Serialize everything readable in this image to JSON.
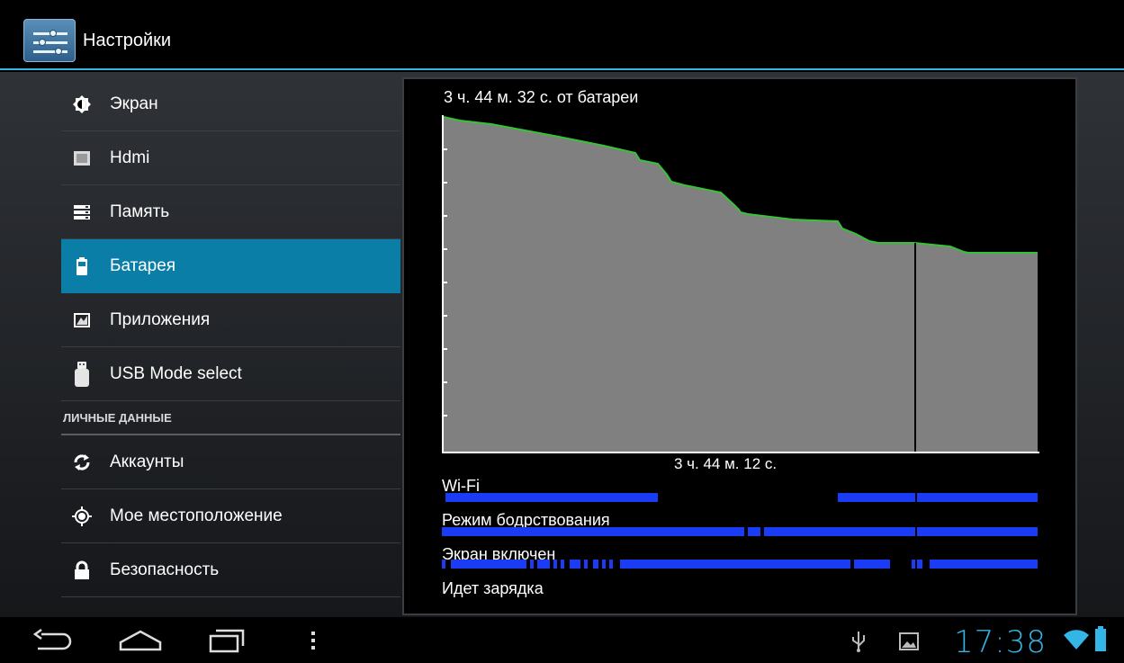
{
  "action_bar": {
    "title": "Настройки",
    "icon": "settings-icon"
  },
  "menu": {
    "items": [
      {
        "label": "Экран",
        "icon": "brightness-icon",
        "active": false
      },
      {
        "label": "Hdmi",
        "icon": "hdmi-icon",
        "active": false
      },
      {
        "label": "Память",
        "icon": "storage-icon",
        "active": false
      },
      {
        "label": "Батарея",
        "icon": "battery-icon",
        "active": true
      },
      {
        "label": "Приложения",
        "icon": "apps-icon",
        "active": false
      },
      {
        "label": "USB Mode select",
        "icon": "usb-drive-icon",
        "active": false
      }
    ],
    "section_personal": "ЛИЧНЫЕ ДАННЫЕ",
    "personal_items": [
      {
        "label": "Аккаунты",
        "icon": "sync-icon"
      },
      {
        "label": "Мое местоположение",
        "icon": "location-icon"
      },
      {
        "label": "Безопасность",
        "icon": "lock-icon"
      }
    ]
  },
  "battery": {
    "title": "3 ч. 44 м. 32 с. от батареи",
    "graph_time": "3 ч. 44 м. 12 с.",
    "rows": {
      "wifi": "Wi-Fi",
      "awake": "Режим бодрствования",
      "screen_on": "Экран включен",
      "charging": "Идет зарядка"
    }
  },
  "status_bar": {
    "clock": "17:38"
  },
  "colors": {
    "accent": "#33b5e5",
    "selected": "#0b7ea8",
    "bar_blue": "#1a3cf5",
    "graph_line": "#35c435",
    "graph_fill": "#808080"
  }
}
